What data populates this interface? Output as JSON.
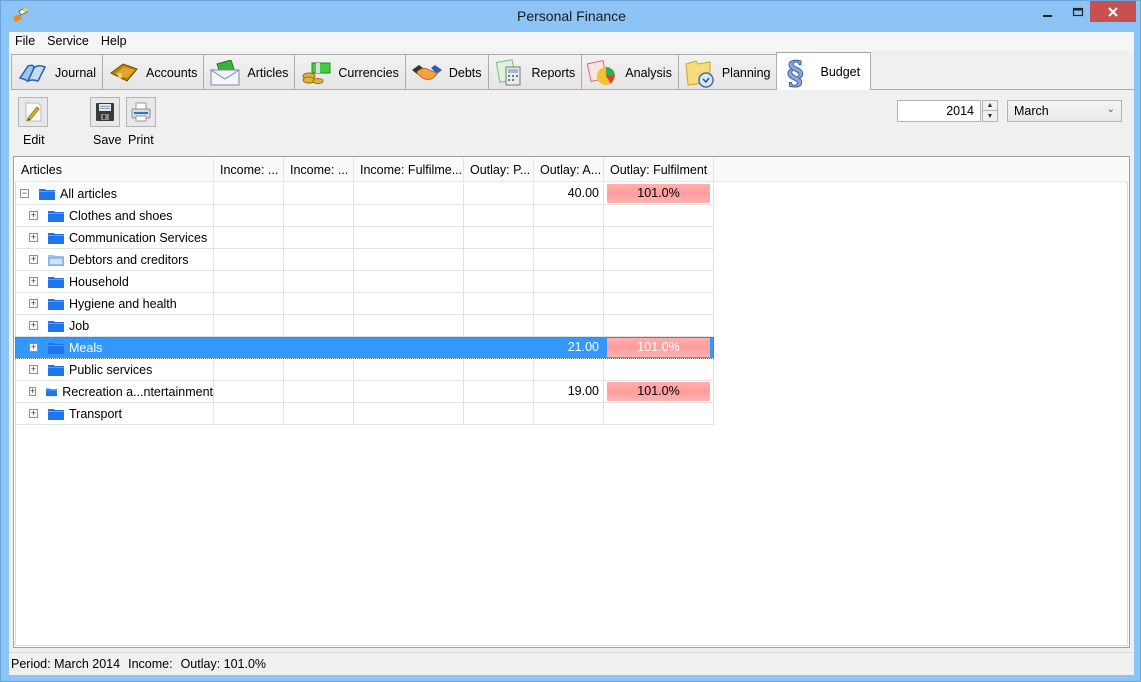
{
  "window": {
    "title": "Personal Finance",
    "controls": {
      "minimize": "–",
      "maximize": "☐",
      "close": "✕"
    }
  },
  "menu": [
    "File",
    "Service",
    "Help"
  ],
  "tabs": [
    {
      "label": "Journal",
      "icon": "book-icon",
      "active": false
    },
    {
      "label": "Accounts",
      "icon": "wallet-icon",
      "active": false
    },
    {
      "label": "Articles",
      "icon": "envelope-money-icon",
      "active": false
    },
    {
      "label": "Currencies",
      "icon": "money-coins-icon",
      "active": false
    },
    {
      "label": "Debts",
      "icon": "handshake-icon",
      "active": false
    },
    {
      "label": "Reports",
      "icon": "calculator-report-icon",
      "active": false
    },
    {
      "label": "Analysis",
      "icon": "pie-chart-icon",
      "active": false
    },
    {
      "label": "Planning",
      "icon": "folder-clock-icon",
      "active": false
    },
    {
      "label": "Budget",
      "icon": "section-sign-icon",
      "active": true
    }
  ],
  "toolbar": {
    "edit_label": "Edit",
    "save_label": "Save",
    "print_label": "Print",
    "year": "2014",
    "month": "March"
  },
  "grid": {
    "columns": [
      "Articles",
      "Income: ...",
      "Income: ...",
      "Income: Fulfilme...",
      "Outlay: P...",
      "Outlay: A...",
      "Outlay: Fulfilment"
    ],
    "rows": [
      {
        "name": "All articles",
        "level": 0,
        "expander": "−",
        "income_plan": "",
        "income_actual": "",
        "income_fulfilment": "",
        "outlay_plan": "",
        "outlay_actual": "40.00",
        "outlay_fulfilment": "101.0%",
        "selected": false
      },
      {
        "name": "Clothes and shoes",
        "level": 1,
        "expander": "+",
        "income_plan": "",
        "income_actual": "",
        "income_fulfilment": "",
        "outlay_plan": "",
        "outlay_actual": "",
        "outlay_fulfilment": "",
        "selected": false
      },
      {
        "name": "Communication Services",
        "level": 1,
        "expander": "+",
        "income_plan": "",
        "income_actual": "",
        "income_fulfilment": "",
        "outlay_plan": "",
        "outlay_actual": "",
        "outlay_fulfilment": "",
        "selected": false
      },
      {
        "name": "Debtors and creditors",
        "level": 1,
        "expander": "+",
        "income_plan": "",
        "income_actual": "",
        "income_fulfilment": "",
        "outlay_plan": "",
        "outlay_actual": "",
        "outlay_fulfilment": "",
        "selected": false,
        "folder_style": "open"
      },
      {
        "name": "Household",
        "level": 1,
        "expander": "+",
        "income_plan": "",
        "income_actual": "",
        "income_fulfilment": "",
        "outlay_plan": "",
        "outlay_actual": "",
        "outlay_fulfilment": "",
        "selected": false
      },
      {
        "name": "Hygiene and health",
        "level": 1,
        "expander": "+",
        "income_plan": "",
        "income_actual": "",
        "income_fulfilment": "",
        "outlay_plan": "",
        "outlay_actual": "",
        "outlay_fulfilment": "",
        "selected": false
      },
      {
        "name": "Job",
        "level": 1,
        "expander": "+",
        "income_plan": "",
        "income_actual": "",
        "income_fulfilment": "",
        "outlay_plan": "",
        "outlay_actual": "",
        "outlay_fulfilment": "",
        "selected": false
      },
      {
        "name": "Meals",
        "level": 1,
        "expander": "+",
        "income_plan": "",
        "income_actual": "",
        "income_fulfilment": "",
        "outlay_plan": "",
        "outlay_actual": "21.00",
        "outlay_fulfilment": "101.0%",
        "selected": true
      },
      {
        "name": "Public services",
        "level": 1,
        "expander": "+",
        "income_plan": "",
        "income_actual": "",
        "income_fulfilment": "",
        "outlay_plan": "",
        "outlay_actual": "",
        "outlay_fulfilment": "",
        "selected": false
      },
      {
        "name": "Recreation a...ntertainment",
        "level": 1,
        "expander": "+",
        "income_plan": "",
        "income_actual": "",
        "income_fulfilment": "",
        "outlay_plan": "",
        "outlay_actual": "19.00",
        "outlay_fulfilment": "101.0%",
        "selected": false
      },
      {
        "name": "Transport",
        "level": 1,
        "expander": "+",
        "income_plan": "",
        "income_actual": "",
        "income_fulfilment": "",
        "outlay_plan": "",
        "outlay_actual": "",
        "outlay_fulfilment": "",
        "selected": false
      }
    ]
  },
  "status": {
    "period": "Period: March 2014",
    "income": "Income:",
    "outlay": "Outlay: 101.0%"
  },
  "colors": {
    "titlebar": "#8cc4f5",
    "close_button": "#c75050",
    "selection": "#3399ff",
    "fulfilment_fill": "#ffa4a4"
  }
}
